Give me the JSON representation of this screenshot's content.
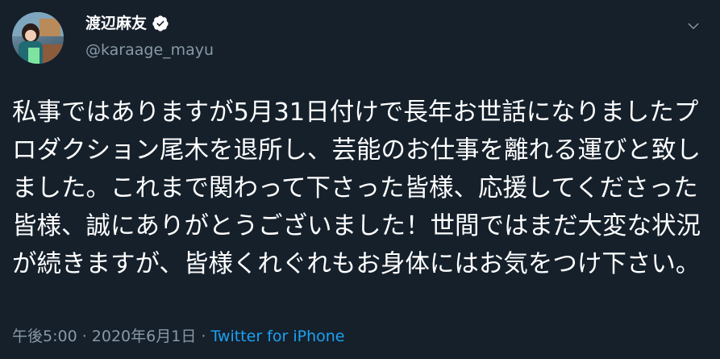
{
  "author": {
    "display_name": "渡辺麻友",
    "handle": "@karaage_mayu",
    "verified": true,
    "avatar": "profile-photo"
  },
  "tweet": {
    "text": "私事ではありますが5月31日付けで長年お世話になりましたプロダクション尾木を退所し、芸能のお仕事を離れる運びと致しました。これまで関わって下さった皆様、応援してくださった皆様、誠にありがとうございました！世間ではまだ大変な状況が続きますが、皆様くれぐれもお身体にはお気をつけ下さい。",
    "time": "午後5:00",
    "separator": " · ",
    "date": "2020年6月1日",
    "source": "Twitter for iPhone"
  },
  "icons": {
    "verified": "verified-badge-icon",
    "menu": "chevron-down-icon"
  },
  "colors": {
    "background": "#15202b",
    "primary_text": "#ffffff",
    "secondary_text": "#8899a6",
    "link": "#1da1f2"
  }
}
